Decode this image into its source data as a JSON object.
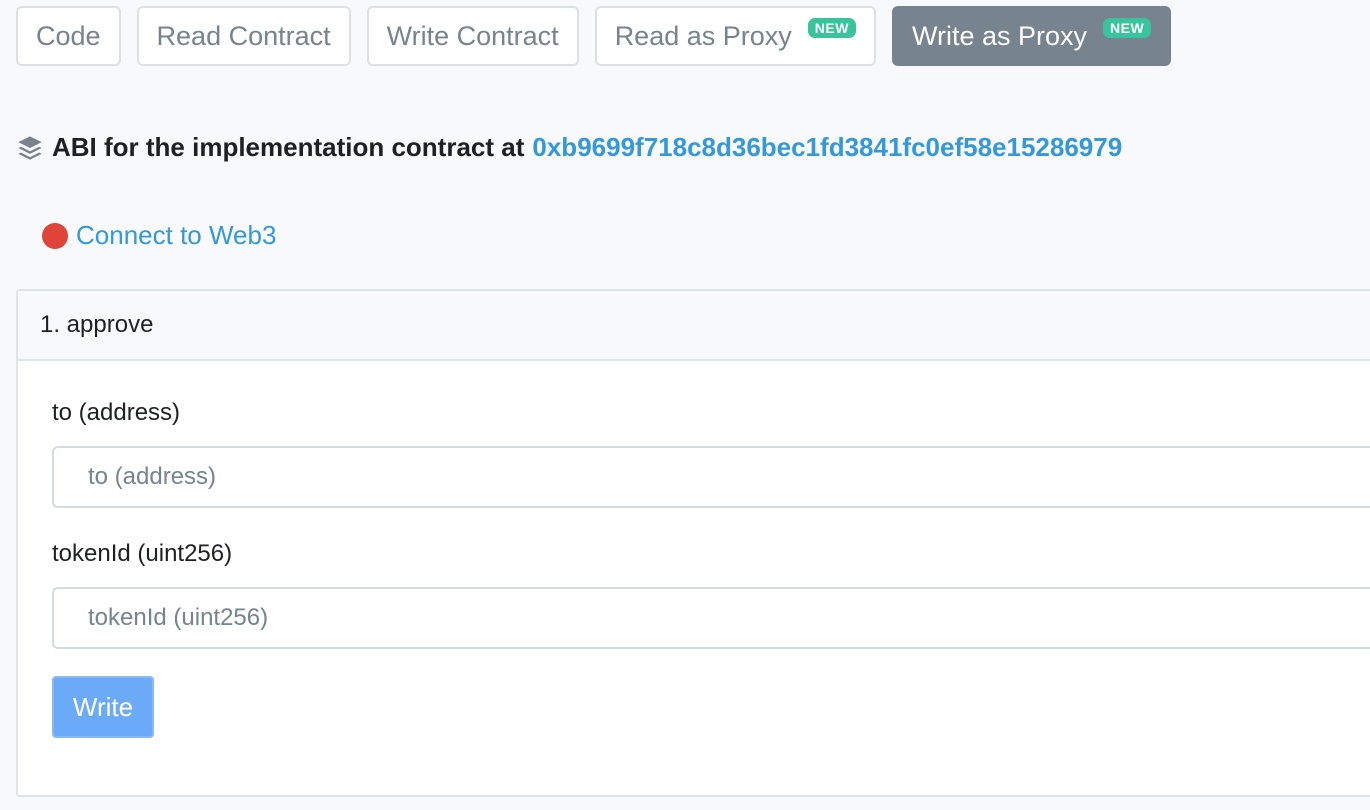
{
  "tabs": [
    {
      "label": "Code",
      "badge": "",
      "active": false
    },
    {
      "label": "Read Contract",
      "badge": "",
      "active": false
    },
    {
      "label": "Write Contract",
      "badge": "",
      "active": false
    },
    {
      "label": "Read as Proxy",
      "badge": "NEW",
      "active": false
    },
    {
      "label": "Write as Proxy",
      "badge": "NEW",
      "active": true
    }
  ],
  "abi": {
    "icon": "layers-icon",
    "heading": "ABI for the implementation contract at",
    "address": "0xb9699f718c8d36bec1fd3841fc0ef58e15286979"
  },
  "connect": {
    "status_color": "#de4437",
    "label": "Connect to Web3"
  },
  "method": {
    "title": "1. approve",
    "fields": [
      {
        "label": "to (address)",
        "placeholder": "to (address)",
        "value": ""
      },
      {
        "label": "tokenId (uint256)",
        "placeholder": "tokenId (uint256)",
        "value": ""
      }
    ],
    "button_label": "Write"
  },
  "colors": {
    "accent": "#3498db",
    "badge": "#3ac49b",
    "active_tab": "#77838f",
    "write_button": "#6aaaf7"
  }
}
